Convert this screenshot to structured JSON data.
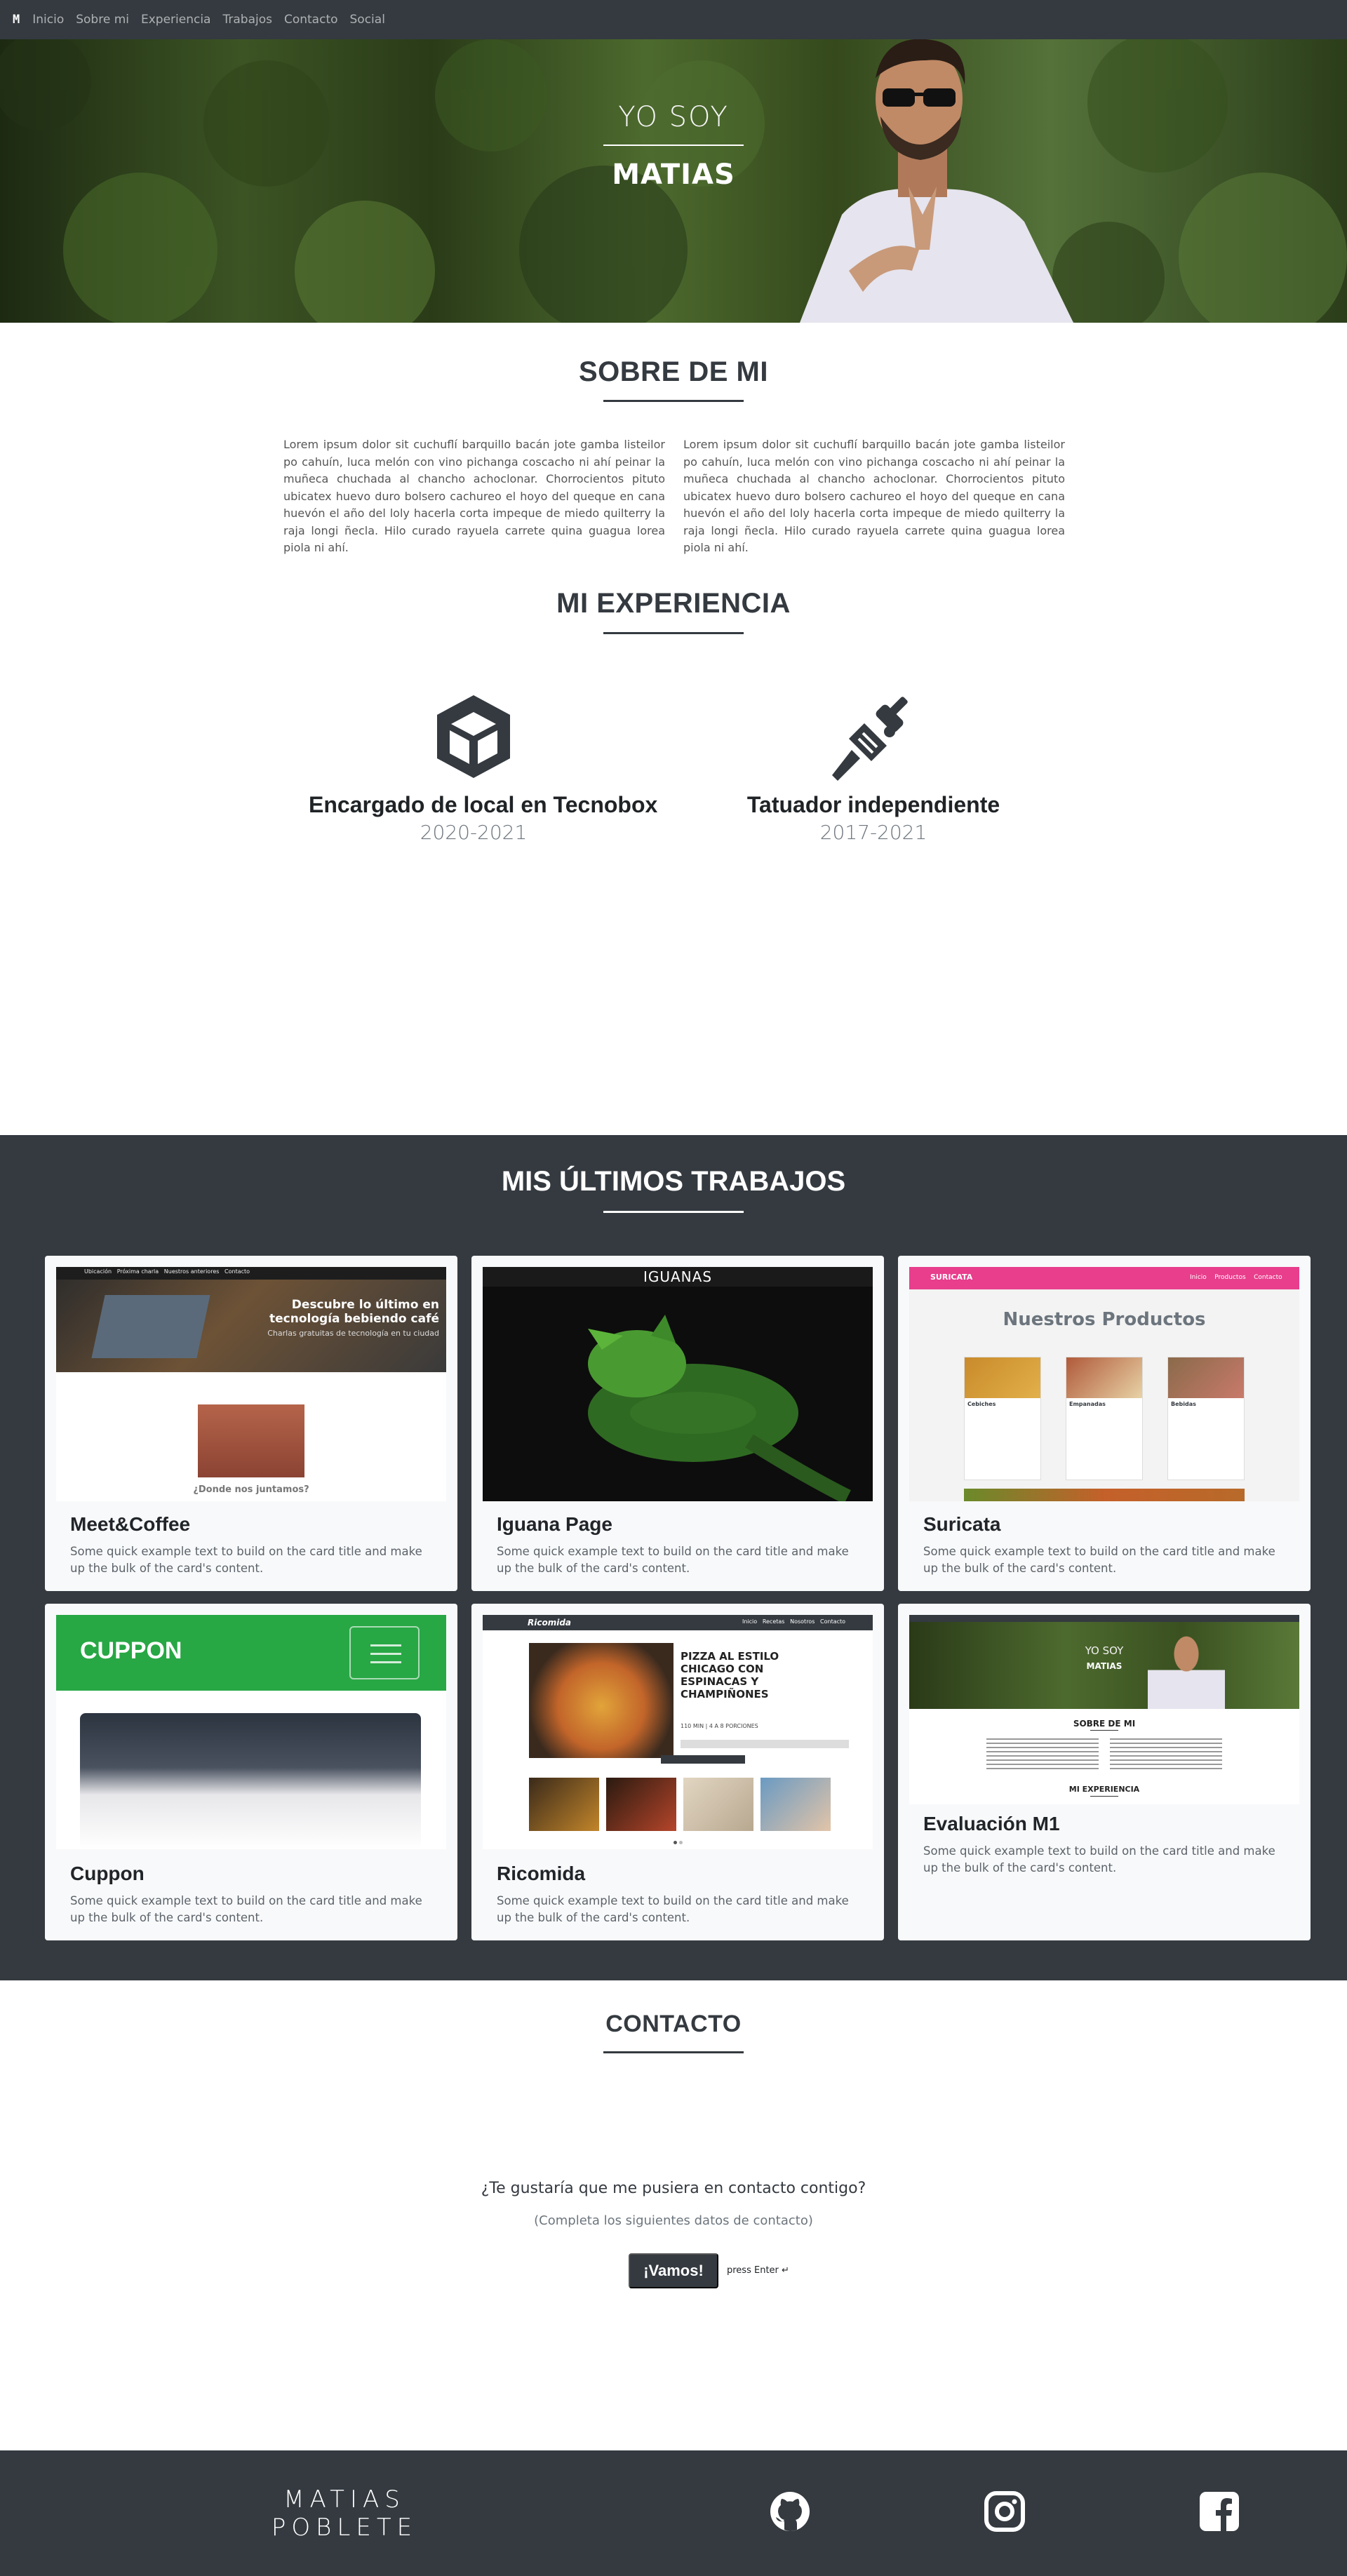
{
  "nav": {
    "brand": "M",
    "links": [
      "Inicio",
      "Sobre mi",
      "Experiencia",
      "Trabajos",
      "Contacto",
      "Social"
    ]
  },
  "hero": {
    "pre_title": "YO SOY",
    "name": "MATIAS"
  },
  "about": {
    "title": "SOBRE DE MI",
    "col1": "Lorem ipsum dolor sit cuchuflí barquillo bacán jote gamba listeilor po cahuín, luca melón con vino pichanga coscacho ni ahí peinar la muñeca chuchada al chancho achoclonar. Chorrocientos pituto ubicatex huevo duro bolsero cachureo el hoyo del queque en cana huevón el año del loly hacerla corta impeque de miedo quilterry la raja longi ñecla. Hilo curado rayuela carrete quina guagua lorea piola ni ahí.",
    "col2": "Lorem ipsum dolor sit cuchuflí barquillo bacán jote gamba listeilor po cahuín, luca melón con vino pichanga coscacho ni ahí peinar la muñeca chuchada al chancho achoclonar. Chorrocientos pituto ubicatex huevo duro bolsero cachureo el hoyo del queque en cana huevón el año del loly hacerla corta impeque de miedo quilterry la raja longi ñecla. Hilo curado rayuela carrete quina guagua lorea piola ni ahí."
  },
  "experience": {
    "title": "MI EXPERIENCIA",
    "items": [
      {
        "icon": "box-icon",
        "role": "Encargado de local en Tecnobox",
        "years": "2020-2021"
      },
      {
        "icon": "tattoo-machine-icon",
        "role": "Tatuador independiente",
        "years": "2017-2021"
      }
    ]
  },
  "works": {
    "title": "MIS ÚLTIMOS TRABAJOS",
    "cards": [
      {
        "title": "Meet&Coffee",
        "text": "Some quick example text to build on the card title and make up the bulk of the card's content.",
        "preview": {
          "nav": [
            "Ubicación",
            "Próxima charla",
            "Nuestros anteriores",
            "Contacto"
          ],
          "headline": "Descubre lo último en tecnología bebiendo café",
          "subline": "Charlas gratuitas de tecnología en tu ciudad",
          "caption": "¿Donde nos juntamos?"
        }
      },
      {
        "title": "Iguana Page",
        "text": "Some quick example text to build on the card title and make up the bulk of the card's content.",
        "preview": {
          "header": "IGUANAS"
        }
      },
      {
        "title": "Suricata",
        "text": "Some quick example text to build on the card title and make up the bulk of the card's content.",
        "preview": {
          "brand": "SURICATA",
          "nav": [
            "Inicio",
            "Productos",
            "Contacto"
          ],
          "heading": "Nuestros Productos",
          "items": [
            "Cebiches",
            "Empanadas",
            "Bebidas"
          ]
        }
      },
      {
        "title": "Cuppon",
        "text": "Some quick example text to build on the card title and make up the bulk of the card's content.",
        "preview": {
          "brand": "CUPPON"
        }
      },
      {
        "title": "Ricomida",
        "text": "Some quick example text to build on the card title and make up the bulk of the card's content.",
        "preview": {
          "brand": "Ricomida",
          "nav": [
            "Inicio",
            "Recetas",
            "Nosotros",
            "Contacto"
          ],
          "headline": "PIZZA AL ESTILO CHICAGO CON ESPINACAS Y CHAMPIÑONES",
          "portions": "110 MIN | 4 A 8 PORCIONES"
        }
      },
      {
        "title": "Evaluación M1",
        "text": "Some quick example text to build on the card title and make up the bulk of the card's content.",
        "preview": {
          "pre": "YO SOY",
          "name": "MATIAS",
          "about": "SOBRE DE MI",
          "exp": "MI EXPERIENCIA"
        }
      }
    ]
  },
  "contact": {
    "title": "CONTACTO",
    "question": "¿Te gustaría que me pusiera en contacto contigo?",
    "subtitle": "(Completa los siguientes datos de contacto)",
    "button": "¡Vamos!",
    "hint": "press Enter ↵"
  },
  "footer": {
    "name_line1": "MATIAS",
    "name_line2": "POBLETE",
    "social": [
      "github-icon",
      "instagram-icon",
      "facebook-icon"
    ]
  },
  "colors": {
    "dark": "#343a40",
    "card_bg": "#f8f9fa",
    "accent_green": "#28a745",
    "accent_pink": "#e83e8c"
  }
}
